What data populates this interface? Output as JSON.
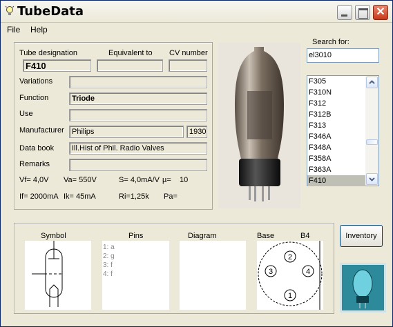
{
  "window": {
    "title": "TubeData"
  },
  "menu": {
    "file": "File",
    "help": "Help"
  },
  "header": {
    "tube_designation_label": "Tube designation",
    "equivalent_label": "Equivalent to",
    "cv_label": "CV number",
    "tube_designation": "F410",
    "equivalent": "",
    "cv_number": ""
  },
  "fields": {
    "variations_label": "Variations",
    "variations": "",
    "function_label": "Function",
    "function": "Triode",
    "use_label": "Use",
    "use": "",
    "manufacturer_label": "Manufacturer",
    "manufacturer": "Philips",
    "year": "1930",
    "databook_label": "Data book",
    "databook": "Ill.Hist of Phil. Radio Valves",
    "remarks_label": "Remarks",
    "remarks": ""
  },
  "specs": {
    "vf": "Vf= 4,0V",
    "va": "Va= 550V",
    "s": "S= 4,0mA/V",
    "mu_label": "µ=",
    "mu": "10",
    "if": "If= 2000mA",
    "ik": "Ik= 45mA",
    "ri": "Ri=1,25k",
    "pa": "Pa="
  },
  "search": {
    "label": "Search for:",
    "value": "el3010",
    "items": [
      "F305",
      "F310N",
      "F312",
      "F312B",
      "F313",
      "F346A",
      "F348A",
      "F358A",
      "F363A",
      "F410"
    ],
    "selected": "F410"
  },
  "bottom": {
    "symbol_label": "Symbol",
    "pins_label": "Pins",
    "diagram_label": "Diagram",
    "base_label": "Base",
    "base_type": "B4",
    "pins": [
      "1: a",
      "2: g",
      "3: f",
      "4: f"
    ],
    "base_pin_numbers": [
      "1",
      "2",
      "3",
      "4"
    ]
  },
  "inventory_button": "Inventory",
  "icons": {
    "app": "lightbulb-icon",
    "minimize": "minimize-icon",
    "maximize": "maximize-icon",
    "close": "close-icon"
  },
  "colors": {
    "titlebar": "#ece9d8",
    "face": "#ece9d8",
    "selection": "#c0bfb5",
    "close": "#c8381a",
    "logo": "#1e6b7c"
  }
}
